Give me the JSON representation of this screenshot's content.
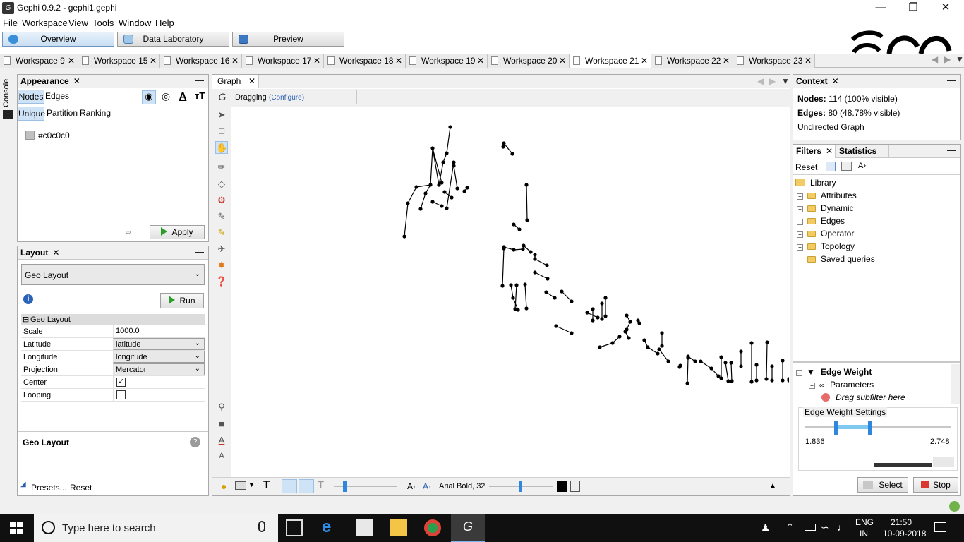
{
  "window": {
    "title": "Gephi 0.9.2 - gephi1.gephi",
    "app_icon": "gephi-logo-icon",
    "controls": [
      "minimize",
      "maximize",
      "close"
    ]
  },
  "menu": [
    "File",
    "Workspace",
    "View",
    "Tools",
    "Window",
    "Help"
  ],
  "modes": [
    {
      "label": "Overview",
      "selected": true
    },
    {
      "label": "Data Laboratory",
      "selected": false
    },
    {
      "label": "Preview",
      "selected": false
    }
  ],
  "workspaces": [
    {
      "label": "Workspace 9"
    },
    {
      "label": "Workspace 15"
    },
    {
      "label": "Workspace 16"
    },
    {
      "label": "Workspace 17"
    },
    {
      "label": "Workspace 18"
    },
    {
      "label": "Workspace 19"
    },
    {
      "label": "Workspace 20"
    },
    {
      "label": "Workspace 21",
      "selected": true
    },
    {
      "label": "Workspace 22"
    },
    {
      "label": "Workspace 23"
    }
  ],
  "console": {
    "label": "Console"
  },
  "appearance": {
    "title": "Appearance",
    "tabs": [
      "Nodes",
      "Edges"
    ],
    "modes": [
      "Unique",
      "Partition",
      "Ranking"
    ],
    "color_value": "#c0c0c0",
    "apply_label": "Apply"
  },
  "layout": {
    "title": "Layout",
    "selected": "Geo Layout",
    "run_label": "Run",
    "section": "Geo Layout",
    "properties": [
      {
        "key": "Scale",
        "value": "1000.0"
      },
      {
        "key": "Latitude",
        "value": "latitude"
      },
      {
        "key": "Longitude",
        "value": "longitude"
      },
      {
        "key": "Projection",
        "value": "Mercator"
      },
      {
        "key": "Center",
        "value": "checked"
      },
      {
        "key": "Looping",
        "value": "unchecked"
      }
    ],
    "description_title": "Geo Layout",
    "presets_label": "Presets...",
    "reset_label": "Reset"
  },
  "graph": {
    "tab": "Graph",
    "mode": "Dragging",
    "configure": "(Configure)",
    "font_label": "Arial Bold, 32"
  },
  "context": {
    "title": "Context",
    "nodes_label": "Nodes:",
    "nodes_value": "114 (100% visible)",
    "edges_label": "Edges:",
    "edges_value": "80 (48.78% visible)",
    "graph_type": "Undirected Graph"
  },
  "filters": {
    "tabs": [
      "Filters",
      "Statistics"
    ],
    "reset_label": "Reset",
    "library_label": "Library",
    "categories": [
      "Attributes",
      "Dynamic",
      "Edges",
      "Operator",
      "Topology",
      "Saved queries"
    ],
    "query": {
      "name": "Edge Weight",
      "parameters": "Parameters",
      "drag_hint": "Drag subfilter here"
    },
    "settings_title": "Edge Weight Settings",
    "range_min": "1.836",
    "range_max": "2.748",
    "select_label": "Select",
    "stop_label": "Stop"
  },
  "taskbar": {
    "search_placeholder": "Type here to search",
    "language": "ENG",
    "region": "IN",
    "time": "21:50",
    "date": "10-09-2018"
  }
}
